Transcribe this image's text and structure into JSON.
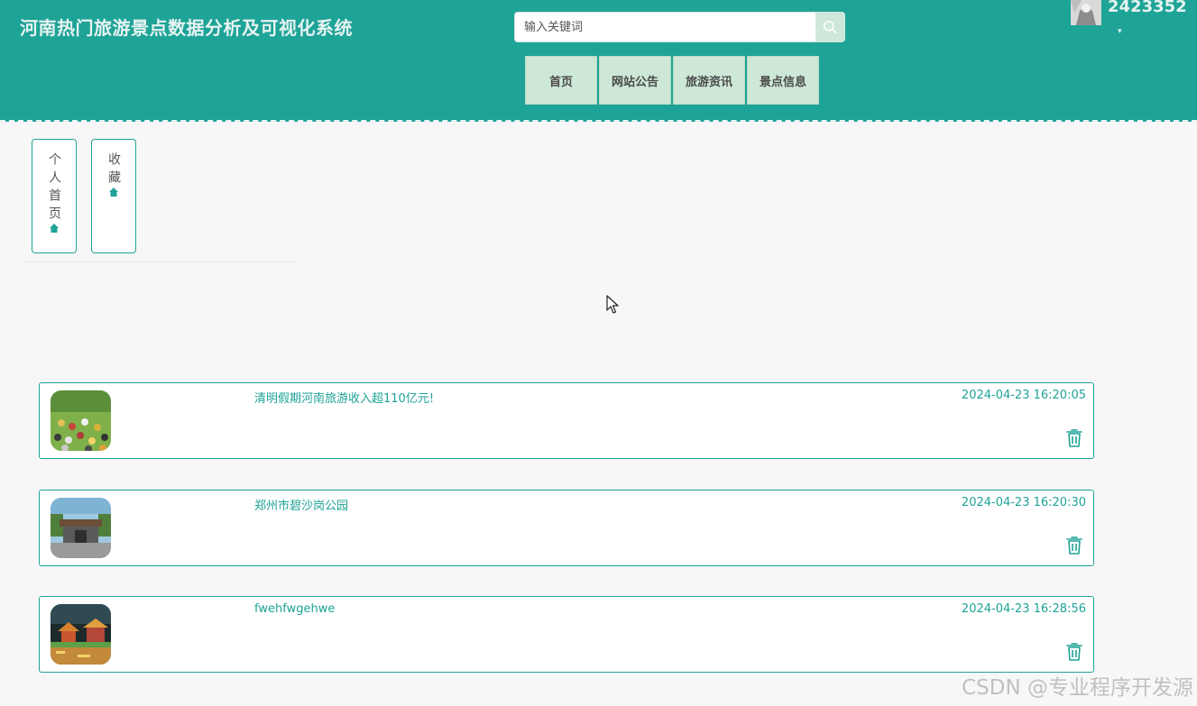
{
  "header": {
    "site_title": "河南热门旅游景点数据分析及可视化系统",
    "search": {
      "placeholder": "输入关键词",
      "value": "",
      "icon": "search-icon"
    },
    "nav": [
      {
        "label": "首页"
      },
      {
        "label": "网站公告"
      },
      {
        "label": "旅游资讯"
      },
      {
        "label": "景点信息"
      }
    ],
    "user": {
      "name": "2423352",
      "caret": "▾"
    }
  },
  "side_menu": [
    {
      "label": "个人首页",
      "icon": "home-icon"
    },
    {
      "label": "收藏",
      "icon": "home-icon"
    }
  ],
  "favorites": [
    {
      "title": "清明假期河南旅游收入超110亿元!",
      "time": "2024-04-23 16:20:05",
      "thumb": "crowd-photo"
    },
    {
      "title": "郑州市碧沙岗公园",
      "time": "2024-04-23 16:20:30",
      "thumb": "park-gate-photo"
    },
    {
      "title": "fwehfwgehwe",
      "time": "2024-04-23 16:28:56",
      "thumb": "night-pavilion-photo"
    }
  ],
  "watermark": "CSDN @专业程序开发源",
  "colors": {
    "primary": "#1ea397",
    "nav_bg": "#cde8d6",
    "page_bg": "#f7f7f7"
  }
}
